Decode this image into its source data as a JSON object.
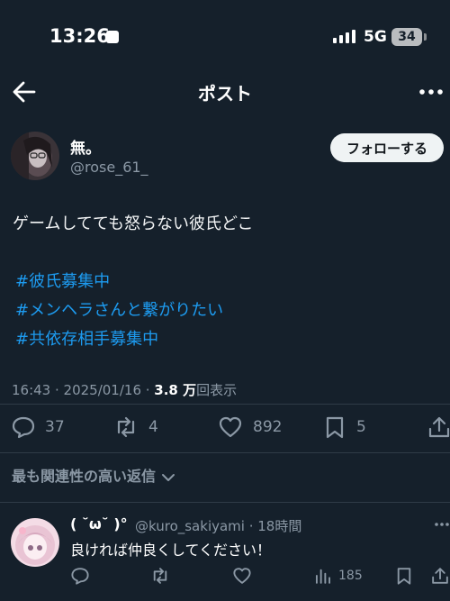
{
  "status_bar": {
    "time": "13:26",
    "network": "5G",
    "battery": "34"
  },
  "header": {
    "title": "ポスト"
  },
  "post": {
    "author_name": "無。",
    "author_handle": "@rose_61_",
    "follow_label": "フォローする",
    "text": "ゲームしてても怒らない彼氏どこ",
    "hashtags": [
      "#彼氏募集中",
      "#メンヘラさんと繋がりたい",
      "#共依存相手募集中"
    ],
    "timestamp": "16:43 · 2025/01/16 · ",
    "views": "3.8 万",
    "views_label": "回表示",
    "replies": "37",
    "reposts": "4",
    "likes": "892",
    "bookmarks": "5"
  },
  "replies_section": {
    "sort_label": "最も関連性の高い返信"
  },
  "reply": {
    "name": "( ˘ω˘ )°",
    "handle": "@kuro_sakiyami · 18時間",
    "text": "良ければ仲良くしてください！",
    "views": "185"
  },
  "colors": {
    "background": "#15202b",
    "accent": "#1d9bf0",
    "muted": "#8b98a5"
  }
}
